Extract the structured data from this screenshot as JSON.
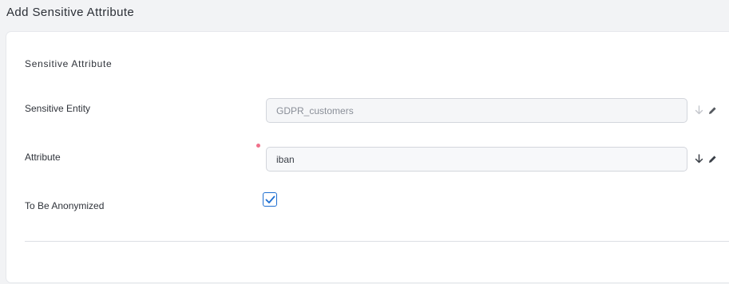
{
  "page": {
    "title": "Add Sensitive Attribute"
  },
  "form": {
    "section_title": "Sensitive Attribute",
    "fields": [
      {
        "label": "Sensitive Entity",
        "value": "GDPR_customers",
        "disabled": true,
        "icons": [
          "arrow-down-icon",
          "pencil-icon"
        ]
      },
      {
        "label": "Attribute",
        "value": "iban",
        "required": true,
        "icons": [
          "arrow-down-icon",
          "pencil-icon"
        ]
      },
      {
        "label": "To Be Anonymized",
        "checked": true
      }
    ]
  },
  "colors": {
    "accent": "#1f6fd1",
    "required": "#f0708a",
    "icon_disabled": "#c3c6cc",
    "icon_active": "#3a3f47"
  }
}
